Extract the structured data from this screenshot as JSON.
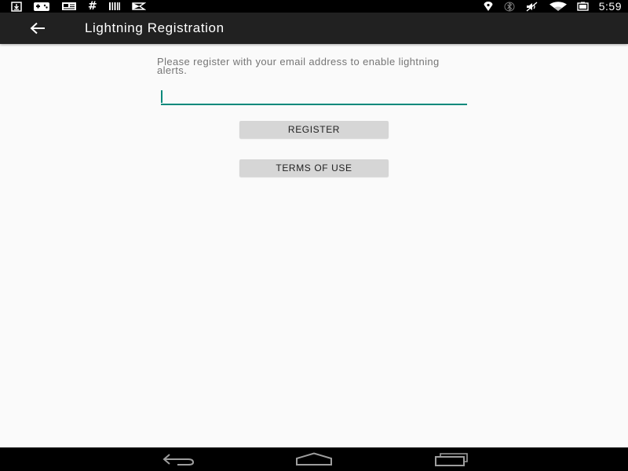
{
  "status_bar": {
    "left_icons": [
      "download-icon",
      "gamepad-icon",
      "news-icon",
      "hash-icon",
      "barcode-icon",
      "flag-icon"
    ],
    "hash_glyph": "#",
    "right_icons": [
      "location-icon",
      "bluetooth-icon",
      "mute-icon",
      "wifi-icon",
      "battery-icon"
    ],
    "time": "5:59"
  },
  "app_bar": {
    "title": "Lightning Registration",
    "background": "#212121"
  },
  "form": {
    "description": "Please register with your email address to enable lightning alerts.",
    "email_value": "",
    "accent": "#00897b",
    "register_label": "REGISTER",
    "terms_label": "TERMS OF USE"
  },
  "nav_bar": {
    "icons": [
      "nav-back-icon",
      "nav-home-icon",
      "nav-recents-icon"
    ]
  }
}
